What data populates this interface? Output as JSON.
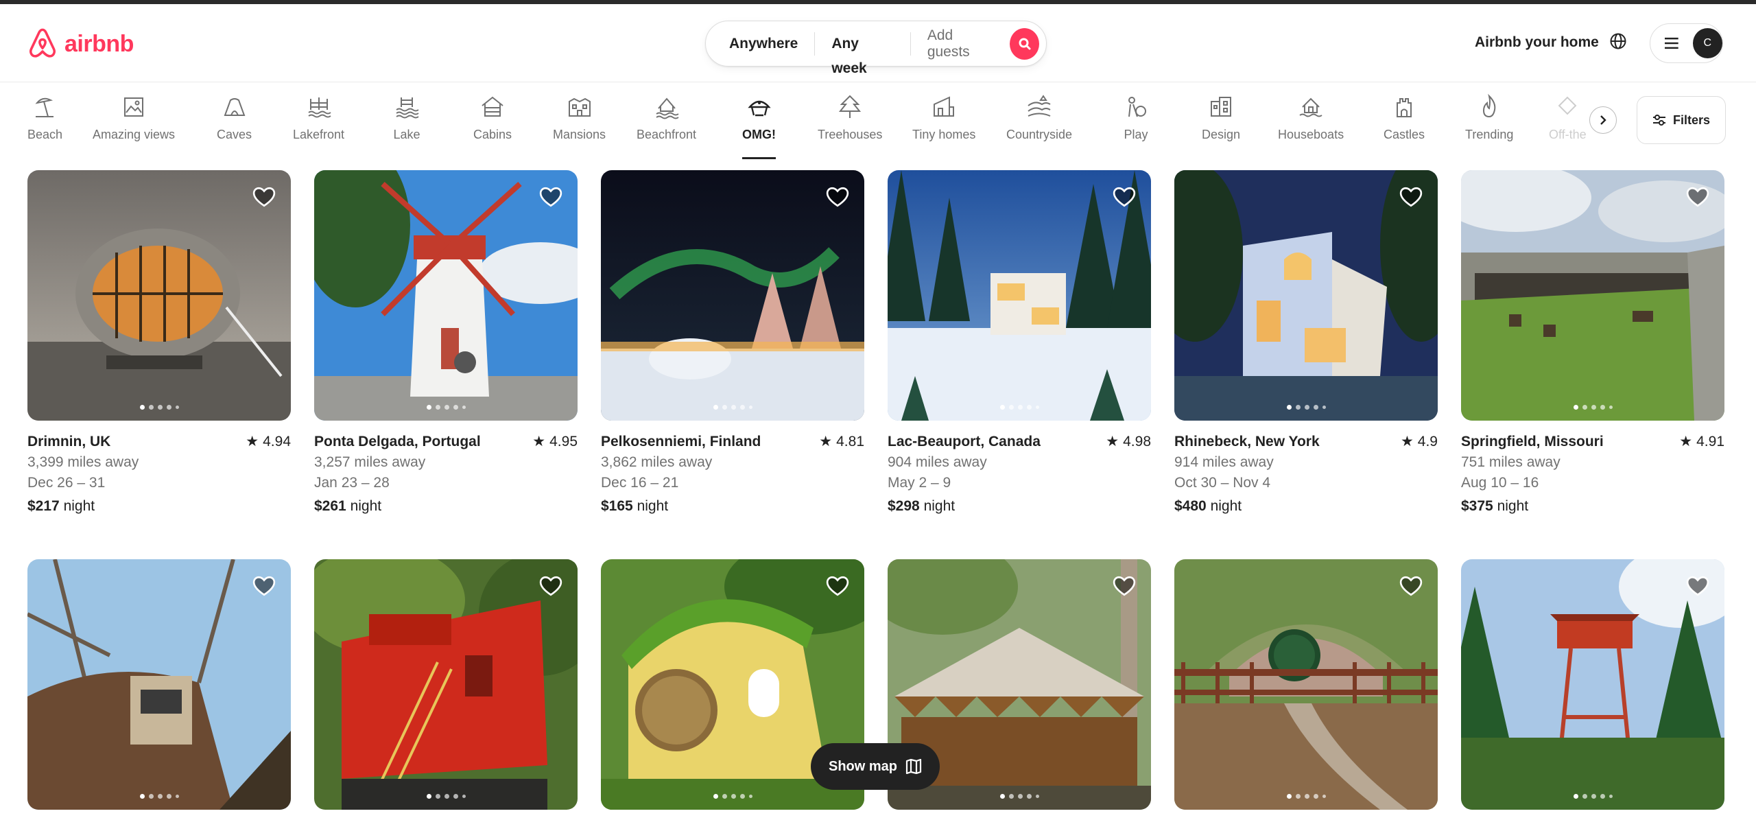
{
  "brand": {
    "name": "airbnb",
    "color": "#ff385c"
  },
  "search": {
    "anywhere": "Anywhere",
    "any_week": "Any week",
    "add_guests": "Add guests"
  },
  "header": {
    "host_link": "Airbnb your home",
    "avatar_initial": "C"
  },
  "categories": [
    {
      "label": "Beach",
      "icon": "beach-icon"
    },
    {
      "label": "Amazing views",
      "icon": "amazing-views-icon"
    },
    {
      "label": "Caves",
      "icon": "caves-icon"
    },
    {
      "label": "Lakefront",
      "icon": "lakefront-icon"
    },
    {
      "label": "Lake",
      "icon": "lake-icon"
    },
    {
      "label": "Cabins",
      "icon": "cabins-icon"
    },
    {
      "label": "Mansions",
      "icon": "mansions-icon"
    },
    {
      "label": "Beachfront",
      "icon": "beachfront-icon"
    },
    {
      "label": "OMG!",
      "icon": "omg-icon",
      "active": true
    },
    {
      "label": "Treehouses",
      "icon": "treehouses-icon"
    },
    {
      "label": "Tiny homes",
      "icon": "tiny-homes-icon"
    },
    {
      "label": "Countryside",
      "icon": "countryside-icon"
    },
    {
      "label": "Play",
      "icon": "play-icon"
    },
    {
      "label": "Design",
      "icon": "design-icon"
    },
    {
      "label": "Houseboats",
      "icon": "houseboats-icon"
    },
    {
      "label": "Castles",
      "icon": "castles-icon"
    },
    {
      "label": "Trending",
      "icon": "trending-icon"
    },
    {
      "label": "Off-the",
      "icon": "off-the-grid-icon"
    }
  ],
  "filters_label": "Filters",
  "listings": [
    {
      "location": "Drimnin, UK",
      "rating": "4.94",
      "distance": "3,399 miles away",
      "dates": "Dec 26 – 31",
      "price": "$217",
      "unit": "night",
      "scene": "glass-pod-cabin"
    },
    {
      "location": "Ponta Delgada, Portugal",
      "rating": "4.95",
      "distance": "3,257 miles away",
      "dates": "Jan 23 – 28",
      "price": "$261",
      "unit": "night",
      "scene": "windmill"
    },
    {
      "location": "Pelkosenniemi, Finland",
      "rating": "4.81",
      "distance": "3,862 miles away",
      "dates": "Dec 16 – 21",
      "price": "$165",
      "unit": "night",
      "scene": "aurora-igloo"
    },
    {
      "location": "Lac-Beauport, Canada",
      "rating": "4.98",
      "distance": "904 miles away",
      "dates": "May 2 – 9",
      "price": "$298",
      "unit": "night",
      "scene": "snow-modern-house"
    },
    {
      "location": "Rhinebeck, New York",
      "rating": "4.9",
      "distance": "914 miles away",
      "dates": "Oct 30 – Nov 4",
      "price": "$480",
      "unit": "night",
      "scene": "blue-modern-house"
    },
    {
      "location": "Springfield, Missouri",
      "rating": "4.91",
      "distance": "751 miles away",
      "dates": "Aug 10 – 16",
      "price": "$375",
      "unit": "night",
      "scene": "earth-house-lawn"
    },
    {
      "scene": "cliff-treehouse"
    },
    {
      "scene": "red-caboose"
    },
    {
      "scene": "hobbit-cottage"
    },
    {
      "scene": "yurt"
    },
    {
      "scene": "hobbit-hole"
    },
    {
      "scene": "red-tower-treehouse"
    }
  ],
  "show_map": "Show map"
}
